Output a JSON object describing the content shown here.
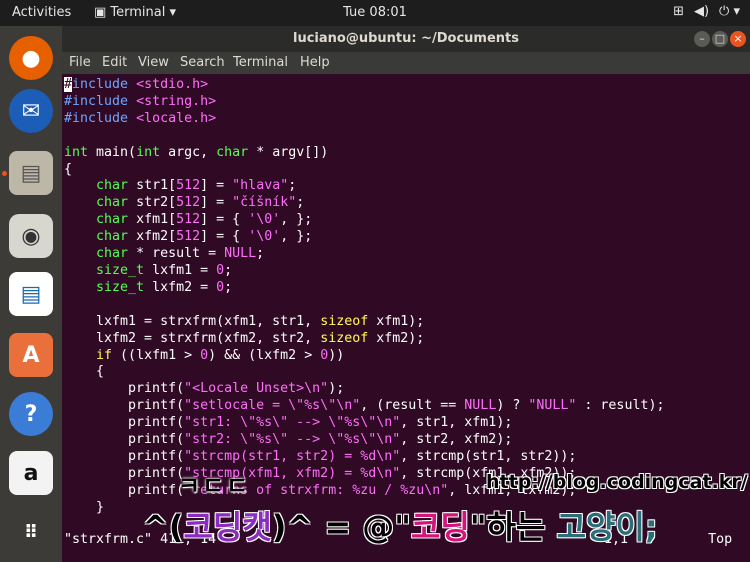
{
  "topbar": {
    "activities": "Activities",
    "app_menu": "Terminal ▾",
    "clock": "Tue 08:01",
    "tray_icons": [
      "network-icon",
      "volume-icon",
      "power-icon"
    ]
  },
  "dock": {
    "apps": [
      "firefox-icon",
      "thunderbird-icon",
      "files-icon",
      "rhythmbox-icon",
      "writer-icon",
      "software-icon",
      "help-icon",
      "amazon-icon",
      "app-grid-icon"
    ]
  },
  "window": {
    "title": "luciano@ubuntu: ~/Documents",
    "menu": [
      "File",
      "Edit",
      "View",
      "Search",
      "Terminal",
      "Help"
    ]
  },
  "status_line": {
    "file": "\"strxfrm.c\" 41L, 14",
    "position": "1,1",
    "scroll": "Top"
  },
  "watermark": {
    "small": "ㅋㄷㄷ",
    "url": "http://blog.codingcat.kr/",
    "big_prefix": "^(",
    "big_a": "코딩캣",
    "big_mid": ")^ = @\"",
    "big_b": "코딩",
    "big_c": "\"하는",
    "big_d": " 고양이;"
  },
  "colors": {
    "terminal_bg": "#300a24",
    "keyword": "#ffff54",
    "type": "#54ff54",
    "string": "#ff6efa",
    "preprocessor": "#6ea5ff"
  }
}
